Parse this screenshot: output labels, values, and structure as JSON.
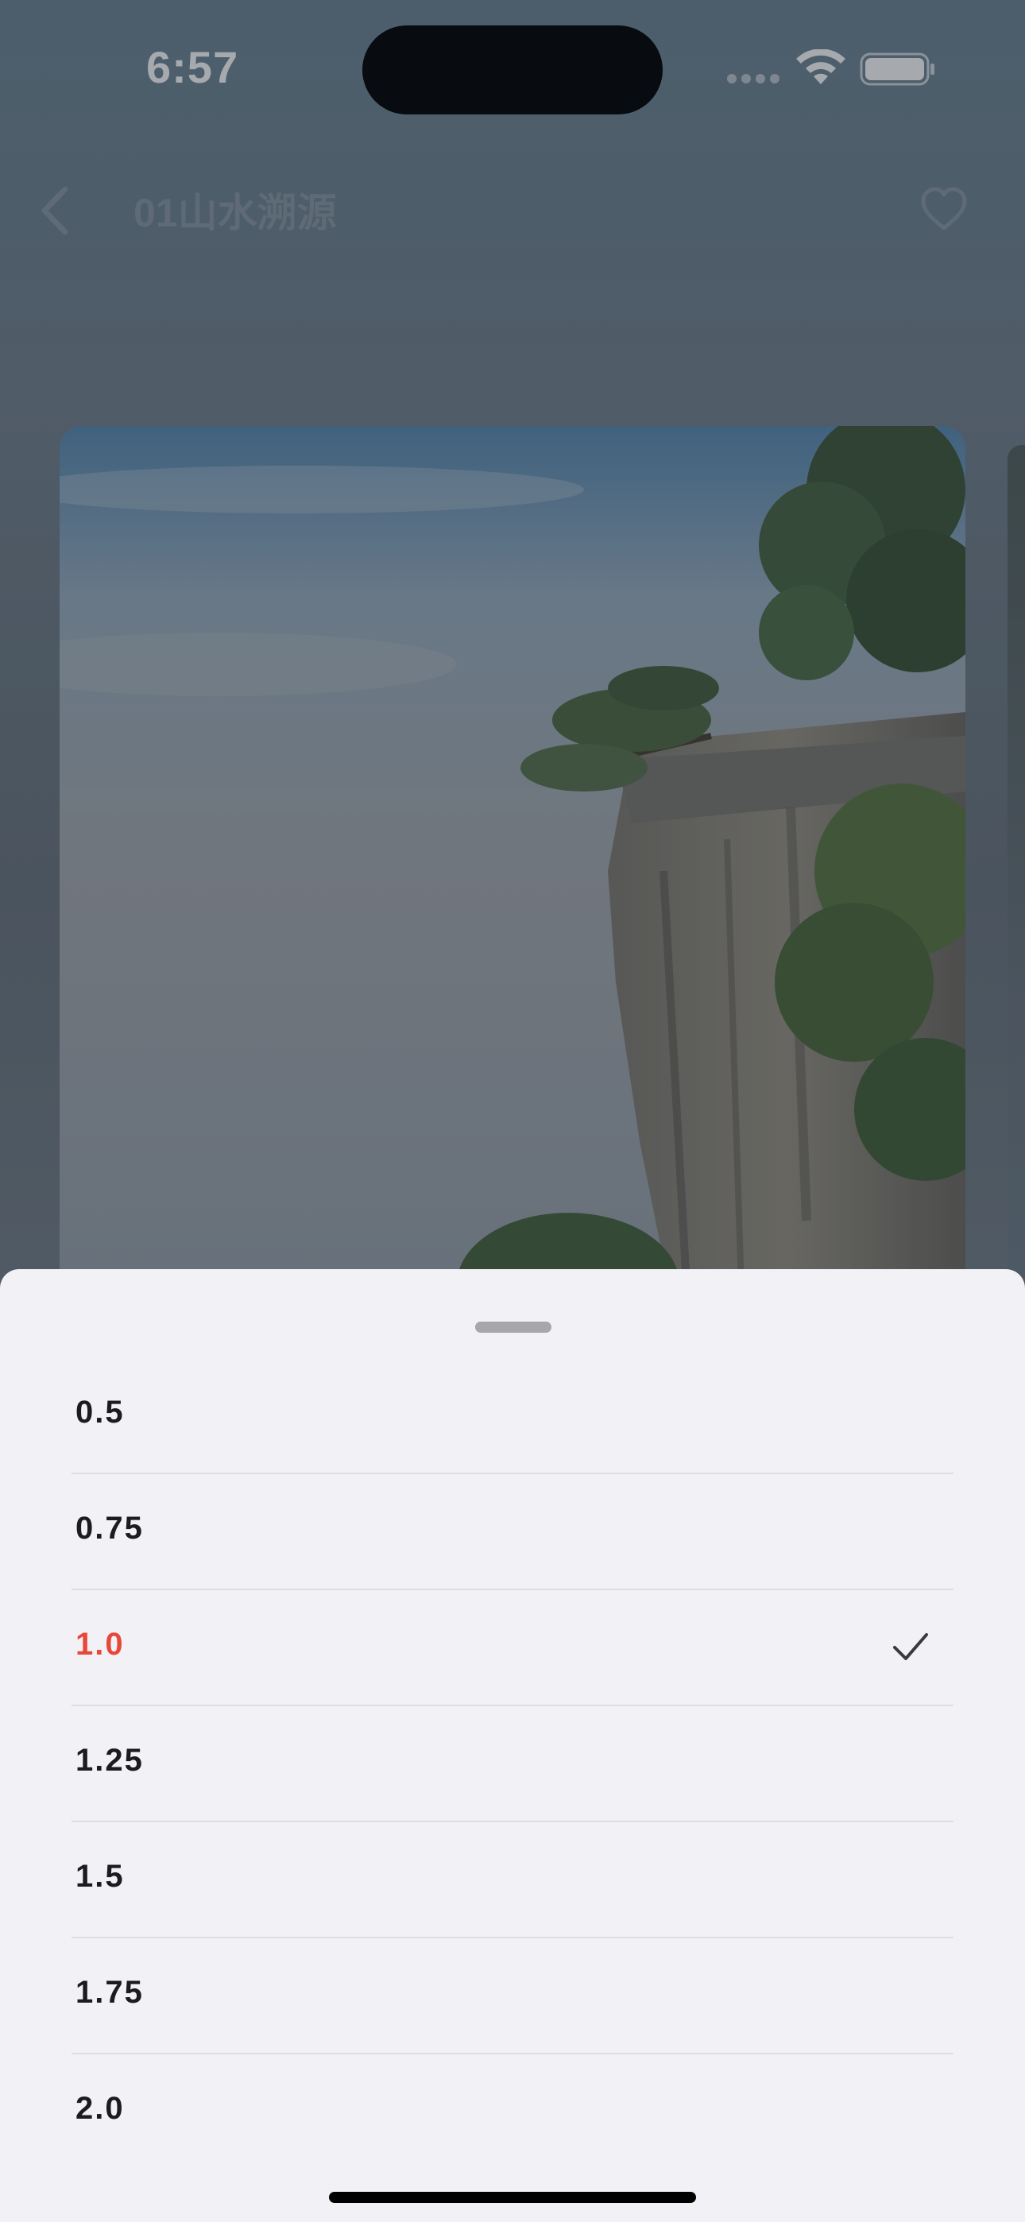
{
  "status_bar": {
    "time": "6:57",
    "icons": [
      "signal-icon",
      "wifi-icon",
      "battery-icon"
    ]
  },
  "nav": {
    "back_icon": "chevron-left-icon",
    "title": "01山水溯源",
    "favorite_icon": "heart-outline-icon"
  },
  "cover": {
    "description_icon": "cover-artwork"
  },
  "speed_sheet": {
    "options": [
      {
        "label": "0.5",
        "selected": false
      },
      {
        "label": "0.75",
        "selected": false
      },
      {
        "label": "1.0",
        "selected": true
      },
      {
        "label": "1.25",
        "selected": false
      },
      {
        "label": "1.5",
        "selected": false
      },
      {
        "label": "1.75",
        "selected": false
      },
      {
        "label": "2.0",
        "selected": false
      }
    ],
    "selected_color": "#e8483a",
    "check_icon": "checkmark-icon"
  },
  "colors": {
    "sheet_background": "#f2f1f6",
    "text_primary": "#1c1c1e",
    "accent": "#e8483a"
  }
}
